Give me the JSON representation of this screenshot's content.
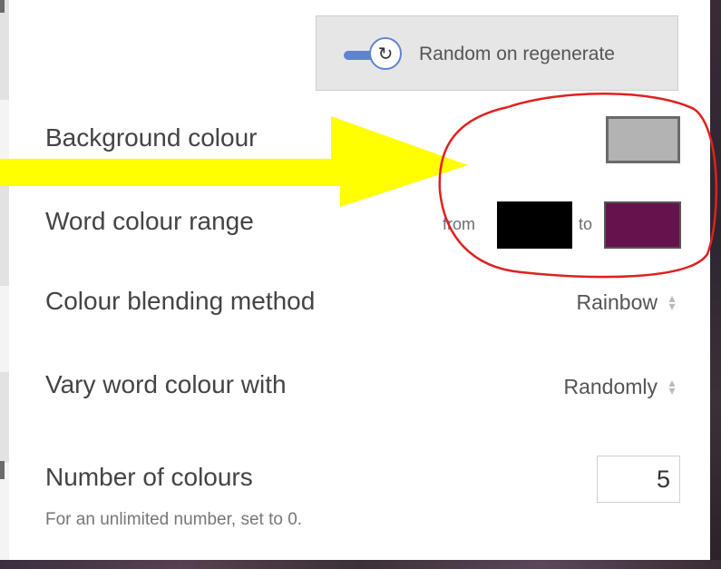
{
  "regenerate": {
    "label": "Random on regenerate",
    "icon": "refresh-icon",
    "toggle_on": true
  },
  "settings": {
    "background": {
      "label": "Background colour",
      "color": "#b3b3b3"
    },
    "word_range": {
      "label": "Word colour range",
      "from_label": "from",
      "to_label": "to",
      "from_color": "#000000",
      "to_color": "#66124d"
    },
    "blending": {
      "label": "Colour blending method",
      "value": "Rainbow"
    },
    "vary": {
      "label": "Vary word colour with",
      "value": "Randomly"
    },
    "number": {
      "label": "Number of colours",
      "value": "5",
      "hint": "For an unlimited number, set to 0."
    }
  },
  "annotations": {
    "arrow_color": "#ffff00",
    "circle_color": "#e02020"
  }
}
